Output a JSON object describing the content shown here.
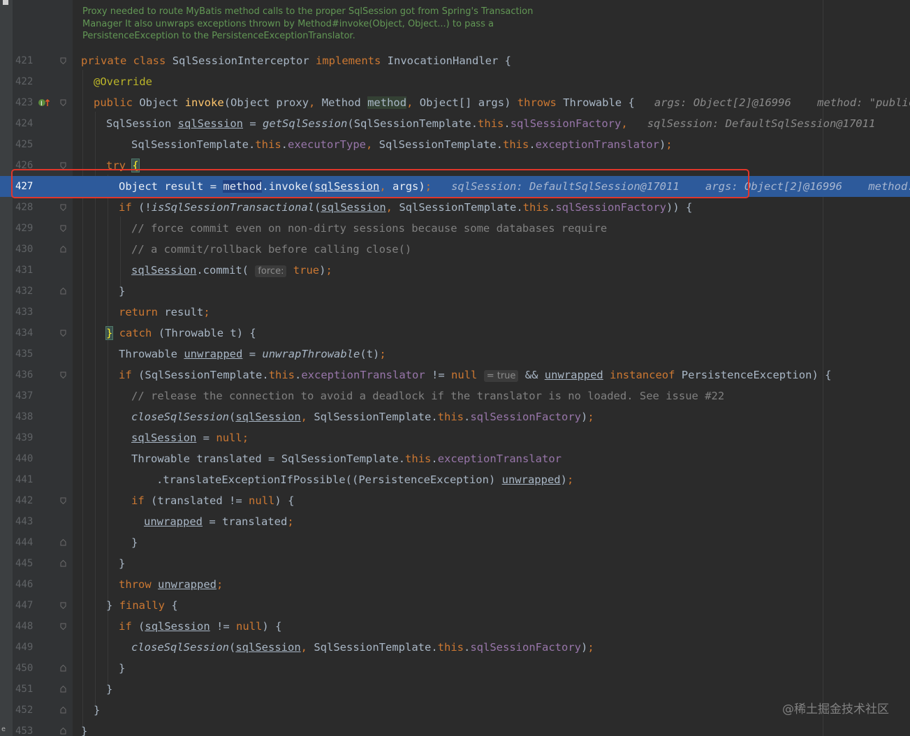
{
  "left_strip": {
    "label": "e"
  },
  "doc_comment": [
    "Proxy needed to route MyBatis method calls to the proper SqlSession got from Spring's Transaction",
    "Manager It also unwraps exceptions thrown by Method#invoke(Object, Object...) to pass a",
    "PersistenceException to the PersistenceExceptionTranslator."
  ],
  "line_numbers": [
    "421",
    "422",
    "423",
    "424",
    "425",
    "426",
    "427",
    "428",
    "429",
    "430",
    "431",
    "432",
    "433",
    "434",
    "435",
    "436",
    "437",
    "438",
    "439",
    "440",
    "441",
    "442",
    "443",
    "444",
    "445",
    "446",
    "447",
    "448",
    "449",
    "450",
    "451",
    "452",
    "453"
  ],
  "current_line": "427",
  "colors": {
    "background": "#2b2b2b",
    "execution_line": "#2d5a9b",
    "keyword": "#cc7832",
    "method": "#ffc66d",
    "field": "#9876aa",
    "comment": "#808080",
    "highlight_box": "#e0362a"
  },
  "icons": [
    "override-implementation-icon",
    "fold-marker-icon"
  ],
  "watermark": "@稀土掘金技术社区",
  "t": {
    "private": "private",
    "class": "class",
    "SqlSessionInterceptor": "SqlSessionInterceptor",
    "implements": "implements",
    "InvocationHandler": "InvocationHandler",
    "lbrace": "{",
    "rbrace": "}",
    "override": "@Override",
    "public": "public",
    "Object": "Object",
    "invoke": "invoke",
    "lparen": "(",
    "proxy": "proxy",
    "comma": ",",
    "Method": "Method",
    "method": "method",
    "ObjectArr": "Object[]",
    "args": "args",
    "rparen": ")",
    "throws": "throws",
    "Throwable": "Throwable",
    "hint_args": "args: Object[2]@16996",
    "hint_method": "method: \"public abst",
    "SqlSession": "SqlSession",
    "sqlSession": "sqlSession",
    "eq": "=",
    "getSqlSession": "getSqlSession",
    "SqlSessionTemplate": "SqlSessionTemplate",
    "dot": ".",
    "this": "this",
    "sqlSessionFactory": "sqlSessionFactory",
    "executorType": "executorType",
    "exceptionTranslator": "exceptionTranslator",
    "hint_sqlSession": "sqlSession: DefaultSqlSession@17011",
    "semi": ";",
    "try": "try",
    "result": "result",
    "dot_invoke": ".invoke(",
    "hint_sqlSession_exec": "sqlSession: DefaultSqlSession@17011",
    "hint_args_exec": "args: Object[2]@16996",
    "hint_method_exec": "method: \"pub",
    "if": "if",
    "not": "(!",
    "isSqlSessionTransactional": "isSqlSessionTransactional",
    "cmt429": "// force commit even on non-dirty sessions because some databases require",
    "cmt430": "// a commit/rollback before calling close()",
    "commit": ".commit(",
    "force_chip": "force:",
    "true": "true",
    "return": "return",
    "catch": "catch",
    "t": "t",
    "unwrapped": "unwrapped",
    "unwrapThrowable": "unwrapThrowable",
    "neq": "!=",
    "null": "null",
    "true_chip": "= true",
    "and": "&&",
    "instanceof": "instanceof",
    "PersistenceException": "PersistenceException",
    "cmt437": "// release the connection to avoid a deadlock if the translator is no loaded. See issue #22",
    "closeSqlSession": "closeSqlSession",
    "translated": "translated",
    "translateExceptionIfPossible": ".translateExceptionIfPossible(",
    "throw": "throw",
    "finally": "finally"
  }
}
